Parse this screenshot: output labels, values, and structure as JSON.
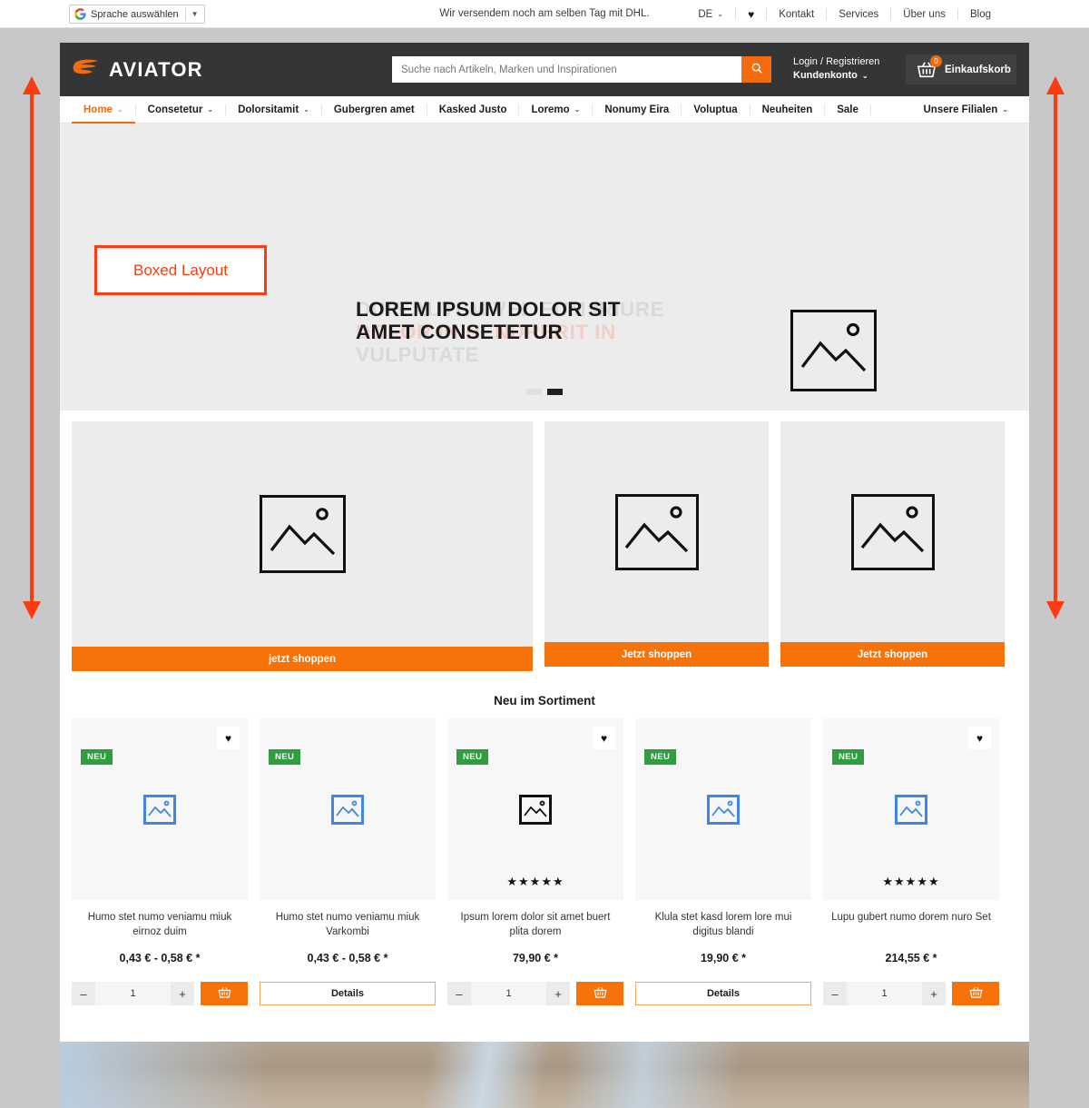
{
  "annotation": {
    "label": "Boxed Layout",
    "color": "#fb3b10"
  },
  "topbar": {
    "translate_label": "Sprache auswählen",
    "translate_caret": "▼",
    "shipping_note": "Wir versendem noch am selben Tag mit DHL.",
    "links": [
      {
        "label": "DE",
        "caret": "⌄",
        "name": "language-selector"
      },
      {
        "label": "♥",
        "caret": "",
        "name": "wishlist-icon"
      },
      {
        "label": "Kontakt",
        "caret": "",
        "name": "contact-link"
      },
      {
        "label": "Services",
        "caret": "",
        "name": "services-link"
      },
      {
        "label": "Über uns",
        "caret": "",
        "name": "about-link"
      },
      {
        "label": "Blog",
        "caret": "",
        "name": "blog-link"
      }
    ]
  },
  "header": {
    "brand": "AVIATOR",
    "search_placeholder": "Suche nach Artikeln, Marken und Inspirationen",
    "search_value": "",
    "account_line1": "Login / Registrieren",
    "account_line2": "Kundenkonto",
    "account_caret": "⌄",
    "cart_label": "Einkaufskorb",
    "cart_count": "0",
    "accent_color": "#f36b0e",
    "header_bg": "#333537"
  },
  "nav": {
    "items": [
      {
        "label": "Home",
        "caret": "⌄",
        "active": true
      },
      {
        "label": "Consetetur",
        "caret": "⌄",
        "active": false
      },
      {
        "label": "Dolorsitamit",
        "caret": "⌄",
        "active": false
      },
      {
        "label": "Gubergren amet",
        "caret": "",
        "active": false
      },
      {
        "label": "Kasked Justo",
        "caret": "",
        "active": false
      },
      {
        "label": "Loremo",
        "caret": "⌄",
        "active": false
      },
      {
        "label": "Nonumy Eira",
        "caret": "",
        "active": false
      },
      {
        "label": "Voluptua",
        "caret": "",
        "active": false
      },
      {
        "label": "Neuheiten",
        "caret": "",
        "active": false
      },
      {
        "label": "Sale",
        "caret": "",
        "active": false
      }
    ],
    "right_item": {
      "label": "Unsere Filialen",
      "caret": "⌄"
    }
  },
  "hero": {
    "headline_main_line1": "LOREM IPSUM DOLOR SIT",
    "headline_main_line2": "AMET CONSETETUR",
    "headline_ghost_line1": "DUIS AUTEM VEL EUM IRIURE",
    "headline_ghost_line2": "DOLOR IN HENDRERIT IN",
    "headline_ghost_line3": "VULPUTATE",
    "dots": [
      {
        "state": "off"
      },
      {
        "state": "on"
      }
    ],
    "image_icon": "image-placeholder-icon"
  },
  "tiles": [
    {
      "button_label": "jetzt shoppen",
      "image_icon": "image-placeholder-icon"
    },
    {
      "button_label": "Jetzt shoppen",
      "image_icon": "image-placeholder-icon"
    },
    {
      "button_label": "Jetzt shoppen",
      "image_icon": "image-placeholder-icon"
    }
  ],
  "products_section": {
    "title": "Neu im Sortiment",
    "items": [
      {
        "badge": "NEU",
        "favorite": true,
        "name": "Humo stet numo veniamu miuk eirnoz duim",
        "price": "0,43 € - 0,58 € *",
        "stars": "",
        "icon_style": "blue",
        "action": "stepper",
        "quantity": "1",
        "minus": "–",
        "plus": "+",
        "cart_icon": "basket-icon",
        "details_label": ""
      },
      {
        "badge": "NEU",
        "favorite": false,
        "name": "Humo stet numo veniamu miuk Varkombi",
        "price": "0,43 € - 0,58 € *",
        "stars": "",
        "icon_style": "blue",
        "action": "details",
        "quantity": "",
        "minus": "",
        "plus": "",
        "cart_icon": "",
        "details_label": "Details"
      },
      {
        "badge": "NEU",
        "favorite": true,
        "name": "Ipsum lorem dolor sit amet buert plita dorem",
        "price": "79,90 € *",
        "stars": "★★★★★",
        "icon_style": "black",
        "action": "stepper",
        "quantity": "1",
        "minus": "–",
        "plus": "+",
        "cart_icon": "basket-icon",
        "details_label": ""
      },
      {
        "badge": "NEU",
        "favorite": false,
        "name": "Klula stet kasd lorem lore mui digitus blandi",
        "price": "19,90 € *",
        "stars": "",
        "icon_style": "blue",
        "action": "details",
        "quantity": "",
        "minus": "",
        "plus": "",
        "cart_icon": "",
        "details_label": "Details"
      },
      {
        "badge": "NEU",
        "favorite": true,
        "name": "Lupu gubert numo dorem nuro Set",
        "price": "214,55 € *",
        "stars": "★★★★★",
        "icon_style": "blue",
        "action": "stepper",
        "quantity": "1",
        "minus": "–",
        "plus": "+",
        "cart_icon": "basket-icon",
        "details_label": ""
      }
    ]
  }
}
